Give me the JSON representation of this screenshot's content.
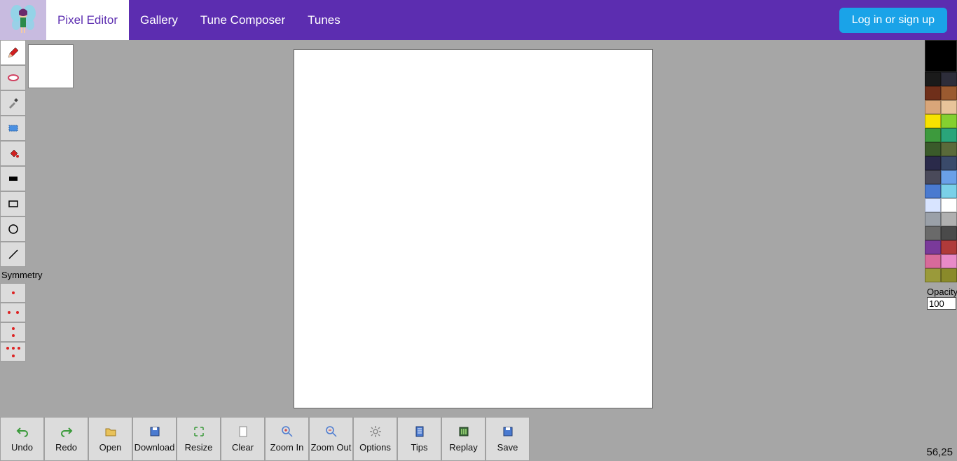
{
  "nav": {
    "tabs": [
      "Pixel Editor",
      "Gallery",
      "Tune Composer",
      "Tunes"
    ],
    "active_index": 0,
    "login_label": "Log in or sign up"
  },
  "tools": [
    {
      "name": "pencil",
      "active": true
    },
    {
      "name": "eraser",
      "active": false
    },
    {
      "name": "picker",
      "active": false
    },
    {
      "name": "select",
      "active": false
    },
    {
      "name": "fill",
      "active": false
    },
    {
      "name": "fillrect",
      "active": false
    },
    {
      "name": "rect",
      "active": false
    },
    {
      "name": "circle",
      "active": false
    },
    {
      "name": "line",
      "active": false
    }
  ],
  "symmetry": {
    "label": "Symmetry",
    "modes": [
      "none",
      "horizontal",
      "vertical",
      "both"
    ]
  },
  "palette": {
    "current": "#000000",
    "rows": [
      [
        "#1a1a1a",
        "#2d2d3a"
      ],
      [
        "#6f2f1a",
        "#9a5a30"
      ],
      [
        "#d9a679",
        "#e8c49a"
      ],
      [
        "#f7e200",
        "#84d030"
      ],
      [
        "#3d9a3d",
        "#2aa57a"
      ],
      [
        "#3a5a2a",
        "#5a6a3a"
      ],
      [
        "#2a2a4a",
        "#3a4a6a"
      ],
      [
        "#4a4a5a",
        "#6aa0e8"
      ],
      [
        "#4a7ad0",
        "#7ad0e8"
      ],
      [
        "#d8e4ff",
        "#ffffff"
      ],
      [
        "#9aa0a8",
        "#b0b0b0"
      ],
      [
        "#6a6a6a",
        "#4a4a4a"
      ],
      [
        "#7a3a9a",
        "#b03a3a"
      ],
      [
        "#d86a9a",
        "#e88ac8"
      ],
      [
        "#9a9a3a",
        "#8a8a2a"
      ]
    ],
    "opacity_label": "Opacity",
    "opacity_value": "100"
  },
  "bottom": [
    {
      "name": "undo",
      "label": "Undo"
    },
    {
      "name": "redo",
      "label": "Redo"
    },
    {
      "name": "open",
      "label": "Open"
    },
    {
      "name": "download",
      "label": "Download"
    },
    {
      "name": "resize",
      "label": "Resize"
    },
    {
      "name": "clear",
      "label": "Clear"
    },
    {
      "name": "zoomin",
      "label": "Zoom In"
    },
    {
      "name": "zoomout",
      "label": "Zoom Out"
    },
    {
      "name": "options",
      "label": "Options"
    },
    {
      "name": "tips",
      "label": "Tips"
    },
    {
      "name": "replay",
      "label": "Replay"
    },
    {
      "name": "save",
      "label": "Save"
    }
  ],
  "coord": "56,25"
}
